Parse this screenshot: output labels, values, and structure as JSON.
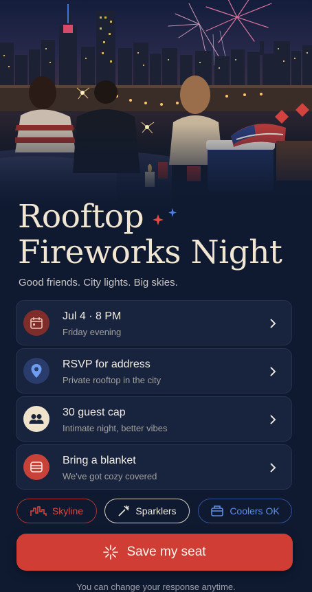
{
  "event": {
    "title_line1": "Rooftop",
    "title_line2": "Fireworks Night",
    "tagline": "Good friends. City lights. Big skies."
  },
  "details": [
    {
      "icon": "calendar-icon",
      "title": "Jul 4 · 8 PM",
      "subtitle": "Friday evening",
      "accent": "#8a2f2c"
    },
    {
      "icon": "location-pin-icon",
      "title": "RSVP for address",
      "subtitle": "Private rooftop in the city",
      "accent": "#2c3f70"
    },
    {
      "icon": "people-icon",
      "title": "30 guest cap",
      "subtitle": "Intimate night, better vibes",
      "accent": "#efe3cc"
    },
    {
      "icon": "blanket-icon",
      "title": "Bring a blanket",
      "subtitle": "We've got cozy covered",
      "accent": "#c8423a"
    }
  ],
  "chips": [
    {
      "icon": "skyline-icon",
      "label": "Skyline",
      "color": "#e0463d"
    },
    {
      "icon": "sparkler-icon",
      "label": "Sparklers",
      "color": "#f1ece2"
    },
    {
      "icon": "cooler-icon",
      "label": "Coolers OK",
      "color": "#5f8ee8"
    }
  ],
  "cta": {
    "icon": "firework-icon",
    "label": "Save my seat",
    "color": "#cf3d34"
  },
  "footnote": "You can change your response anytime."
}
